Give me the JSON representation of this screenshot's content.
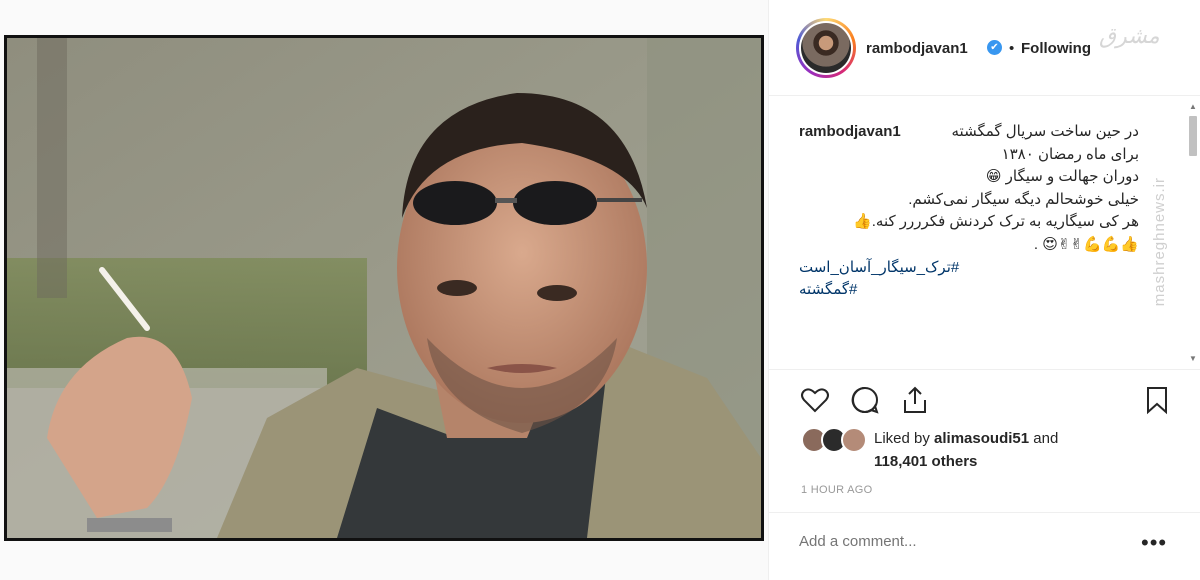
{
  "header": {
    "username": "rambodjavan1",
    "verified_mark": "✔",
    "separator": "•",
    "follow_status": "Following",
    "watermark_logo": "مشرق"
  },
  "caption": {
    "username": "rambodjavan1",
    "lines": [
      "در حین ساخت سریال گمگشته",
      "برای ماه رمضان ۱۳۸۰",
      "دوران جهالت و سیگار 😁",
      "خیلی خوشحالم دیگه سیگار نمی‌کشم.",
      "هر کی سیگاریه به ترک کردنش فکرررر کنه.👍",
      "👍💪💪✌✌😍 ."
    ],
    "hashtags": [
      "#ترک_سیگار_آسان_است",
      "#گمگشته"
    ]
  },
  "side_watermark": "mashreghnews.ir",
  "actions": {
    "like_icon": "heart-icon",
    "comment_icon": "comment-icon",
    "share_icon": "share-icon",
    "save_icon": "bookmark-icon"
  },
  "likes": {
    "prefix": "Liked by ",
    "user": "alimasoudi51",
    "and": " and",
    "count": "118,401 others"
  },
  "timestamp": "1 HOUR AGO",
  "comment": {
    "placeholder": "Add a comment...",
    "more_label": "•••"
  },
  "scrollbar": {
    "up": "▲",
    "down": "▼"
  }
}
